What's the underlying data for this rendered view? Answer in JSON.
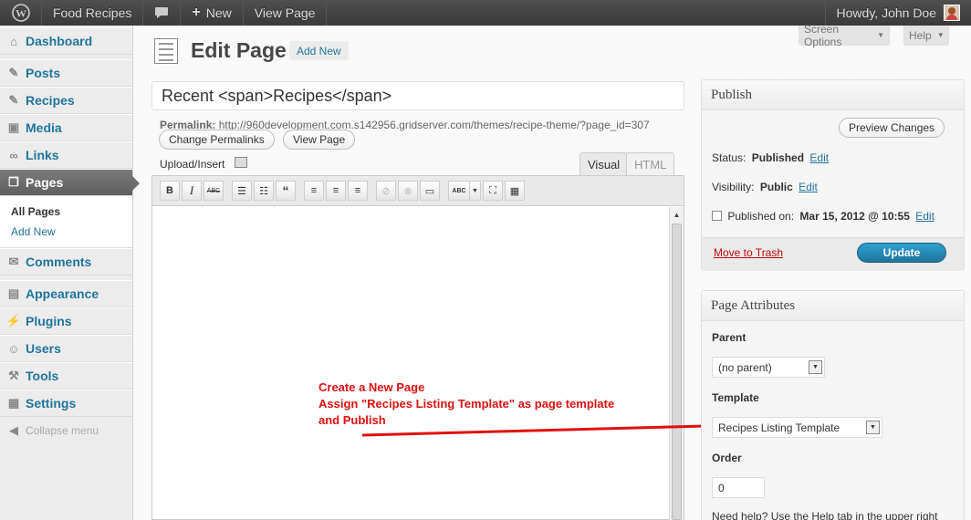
{
  "adminbar": {
    "site_name": "Food Recipes",
    "new_label": "New",
    "view_page": "View Page",
    "howdy": "Howdy, John Doe"
  },
  "sidebar": {
    "items": [
      {
        "label": "Dashboard",
        "icon": "dashboard-icon"
      },
      {
        "label": "Posts",
        "icon": "pin-icon"
      },
      {
        "label": "Recipes",
        "icon": "pin-icon"
      },
      {
        "label": "Media",
        "icon": "media-icon"
      },
      {
        "label": "Links",
        "icon": "link-icon"
      },
      {
        "label": "Pages",
        "icon": "pages-icon"
      },
      {
        "label": "Comments",
        "icon": "comments-icon"
      },
      {
        "label": "Appearance",
        "icon": "appearance-icon"
      },
      {
        "label": "Plugins",
        "icon": "plugins-icon"
      },
      {
        "label": "Users",
        "icon": "users-icon"
      },
      {
        "label": "Tools",
        "icon": "tools-icon"
      },
      {
        "label": "Settings",
        "icon": "settings-icon"
      }
    ],
    "submenu": [
      "All Pages",
      "Add New"
    ],
    "collapse": "Collapse menu"
  },
  "main": {
    "title": "Edit Page",
    "add_new": "Add New",
    "screen_options": "Screen Options",
    "help": "Help",
    "post_title": "Recent <span>Recipes</span>",
    "permalink_label": "Permalink:",
    "permalink_url": "http://960development.com.s142956.gridserver.com/themes/recipe-theme/?page_id=307",
    "change_permalinks": "Change Permalinks",
    "view_page": "View Page",
    "upload_insert": "Upload/Insert",
    "tab_visual": "Visual",
    "tab_html": "HTML"
  },
  "annotation": {
    "line1": "Create a New Page",
    "line2": "Assign \"Recipes Listing Template\" as page template",
    "line3": "and Publish",
    "color": "#e01010"
  },
  "publish": {
    "title": "Publish",
    "preview": "Preview Changes",
    "status_label": "Status:",
    "status_value": "Published",
    "visibility_label": "Visibility:",
    "visibility_value": "Public",
    "edit": "Edit",
    "published_on_label": "Published on:",
    "published_on_value": "Mar 15, 2012 @ 10:55",
    "move_to_trash": "Move to Trash",
    "update": "Update"
  },
  "page_attributes": {
    "title": "Page Attributes",
    "parent_label": "Parent",
    "parent_value": "(no parent)",
    "template_label": "Template",
    "template_value": "Recipes Listing Template",
    "order_label": "Order",
    "order_value": "0",
    "help_text": "Need help? Use the Help tab in the upper right"
  }
}
